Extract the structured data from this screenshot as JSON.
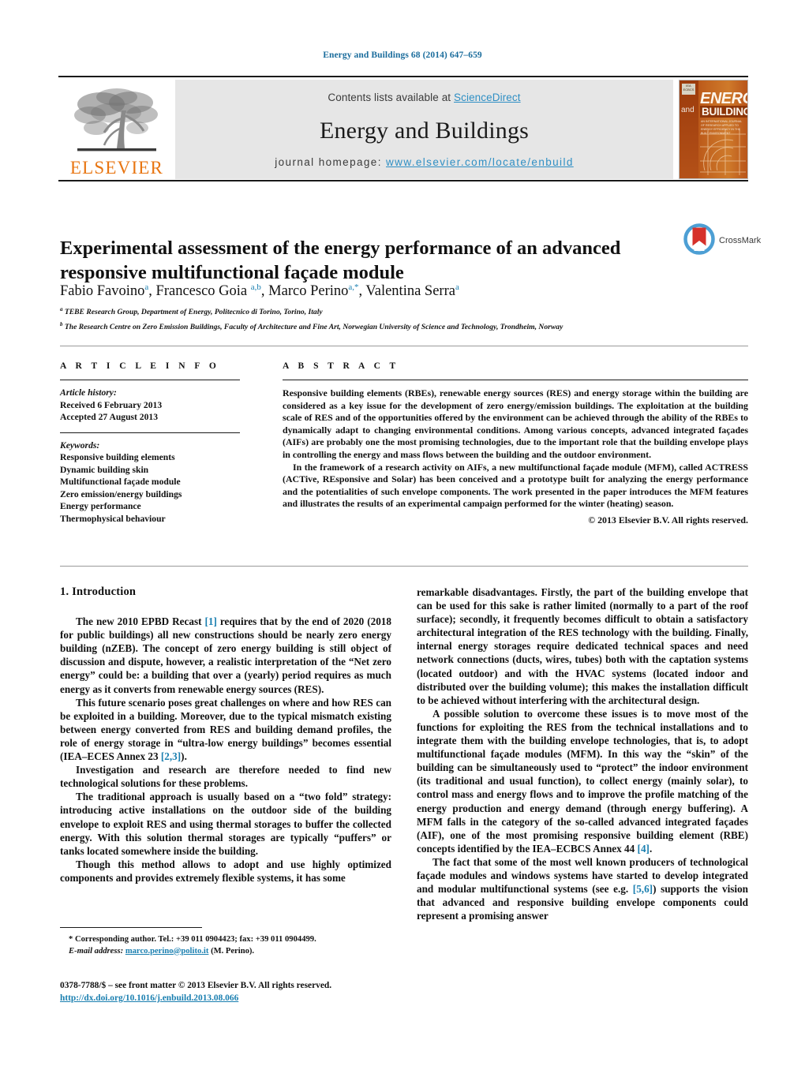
{
  "running_head": "Energy and Buildings 68 (2014) 647–659",
  "masthead": {
    "publisher_name": "ELSEVIER",
    "contents_prefix": "Contents lists available at ",
    "contents_link": "ScienceDirect",
    "journal_title": "Energy and Buildings",
    "homepage_prefix": "journal homepage: ",
    "homepage_url": "www.elsevier.com/locate/enbuild",
    "cover": {
      "and": "and",
      "energy": "ENERGY",
      "buildings": "BUILDINGS",
      "subtitle": "AN INTERNATIONAL JOURNAL OF RESEARCH APPLIED TO ENERGY EFFICIENCY IN THE BUILT ENVIRONMENT"
    }
  },
  "article": {
    "title": "Experimental assessment of the energy performance of an advanced responsive multifunctional façade module",
    "crossmark_label": "CrossMark",
    "authors_html": "Fabio Favoino<sup>a</sup>, Francesco Goia <sup>a,b</sup>, Marco Perino<sup>a,*</sup>, Valentina Serra<sup>a</sup>",
    "affiliations": [
      {
        "marker": "a",
        "text": "TEBE Research Group, Department of Energy, Politecnico di Torino, Torino, Italy"
      },
      {
        "marker": "b",
        "text": "The Research Centre on Zero Emission Buildings, Faculty of Architecture and Fine Art, Norwegian University of Science and Technology, Trondheim, Norway"
      }
    ]
  },
  "article_info": {
    "heading": "A R T I C L E  I N F O",
    "history_label": "Article history:",
    "history": [
      "Received 6 February 2013",
      "Accepted 27 August 2013"
    ],
    "keywords_label": "Keywords:",
    "keywords": [
      "Responsive building elements",
      "Dynamic building skin",
      "Multifunctional façade module",
      "Zero emission/energy buildings",
      "Energy performance",
      "Thermophysical behaviour"
    ]
  },
  "abstract": {
    "heading": "A B S T R A C T",
    "paragraphs": [
      "Responsive building elements (RBEs), renewable energy sources (RES) and energy storage within the building are considered as a key issue for the development of zero energy/emission buildings. The exploitation at the building scale of RES and of the opportunities offered by the environment can be achieved through the ability of the RBEs to dynamically adapt to changing environmental conditions. Among various concepts, advanced integrated façades (AIFs) are probably one the most promising technologies, due to the important role that the building envelope plays in controlling the energy and mass flows between the building and the outdoor environment.",
      "In the framework of a research activity on AIFs, a new multifunctional façade module (MFM), called ACTRESS (ACTive, REsponsive and Solar) has been conceived and a prototype built for analyzing the energy performance and the potentialities of such envelope components. The work presented in the paper introduces the MFM features and illustrates the results of an experimental campaign performed for the winter (heating) season."
    ],
    "copyright": "© 2013 Elsevier B.V. All rights reserved."
  },
  "body": {
    "section_heading": "1.  Introduction",
    "left_paragraphs": [
      "The new 2010 EPBD Recast [1] requires that by the end of 2020 (2018 for public buildings) all new constructions should be nearly zero energy building (nZEB). The concept of zero energy building is still object of discussion and dispute, however, a realistic interpretation of the “Net zero energy” could be: a building that over a (yearly) period requires as much energy as it converts from renewable energy sources (RES).",
      "This future scenario poses great challenges on where and how RES can be exploited in a building. Moreover, due to the typical mismatch existing between energy converted from RES and building demand profiles, the role of energy storage in “ultra-low energy buildings” becomes essential (IEA–ECES Annex 23 [2,3]).",
      "Investigation and research are therefore needed to find new technological solutions for these problems.",
      "The traditional approach is usually based on a “two fold” strategy: introducing active installations on the outdoor side of the building envelope to exploit RES and using thermal storages to buffer the collected energy. With this solution thermal storages are typically “puffers” or tanks located somewhere inside the building.",
      "Though this method allows to adopt and use highly optimized components and provides extremely flexible systems, it has some"
    ],
    "right_paragraphs": [
      "remarkable disadvantages. Firstly, the part of the building envelope that can be used for this sake is rather limited (normally to a part of the roof surface); secondly, it frequently becomes difficult to obtain a satisfactory architectural integration of the RES technology with the building. Finally, internal energy storages require dedicated technical spaces and need network connections (ducts, wires, tubes) both with the captation systems (located outdoor) and with the HVAC systems (located indoor and distributed over the building volume); this makes the installation difficult to be achieved without interfering with the architectural design.",
      "A possible solution to overcome these issues is to move most of the functions for exploiting the RES from the technical installations and to integrate them with the building envelope technologies, that is, to adopt multifunctional façade modules (MFM). In this way the “skin” of the building can be simultaneously used to “protect” the indoor environment (its traditional and usual function), to collect energy (mainly solar), to control mass and energy flows and to improve the profile matching of the energy production and energy demand (through energy buffering). A MFM falls in the category of the so-called advanced integrated façades (AIF), one of the most promising responsive building element (RBE) concepts identified by the IEA–ECBCS Annex 44 [4].",
      "The fact that some of the most well known producers of technological façade modules and windows systems have started to develop integrated and modular multifunctional systems (see e.g. [5,6]) supports the vision that advanced and responsive building envelope components could represent a promising answer"
    ]
  },
  "footnotes": {
    "corresponding": "* Corresponding author. Tel.: +39 011 0904423; fax: +39 011 0904499.",
    "email_label": "E-mail address:",
    "email": "marco.perino@polito.it",
    "email_suffix": "(M. Perino).",
    "issn_line": "0378-7788/$ – see front matter © 2013 Elsevier B.V. All rights reserved.",
    "doi": "http://dx.doi.org/10.1016/j.enbuild.2013.08.066"
  },
  "colors": {
    "link_blue": "#1a7fb0",
    "sciencedirect_blue": "#2f8fc4",
    "elsevier_orange": "#e87511",
    "crossmark_blue": "#4d9fd4",
    "crossmark_red": "#d6312b"
  }
}
